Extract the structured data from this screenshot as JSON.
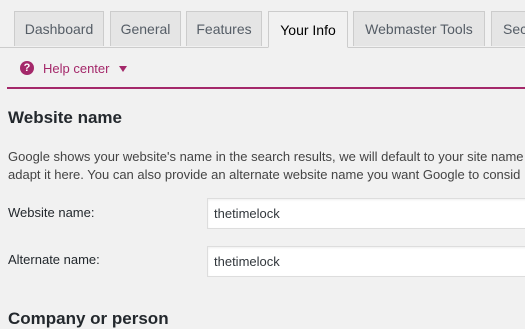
{
  "tabs": [
    {
      "label": "Dashboard",
      "active": false
    },
    {
      "label": "General",
      "active": false
    },
    {
      "label": "Features",
      "active": false
    },
    {
      "label": "Your Info",
      "active": true
    },
    {
      "label": "Webmaster Tools",
      "active": false
    },
    {
      "label": "Sec",
      "active": false
    }
  ],
  "help": {
    "icon": "question-circle-icon",
    "label": "Help center"
  },
  "website_name_section": {
    "title": "Website name",
    "description_line1": "Google shows your website's name in the search results, we will default to your site name",
    "description_line2": "adapt it here. You can also provide an alternate website name you want Google to consid",
    "website_name_label": "Website name:",
    "website_name_value": "thetimelock",
    "alternate_name_label": "Alternate name:",
    "alternate_name_value": "thetimelock"
  },
  "company_section": {
    "title": "Company or person"
  },
  "colors": {
    "accent": "#a4286a",
    "background": "#f1f1f1",
    "tab_inactive": "#e5e5e5"
  }
}
